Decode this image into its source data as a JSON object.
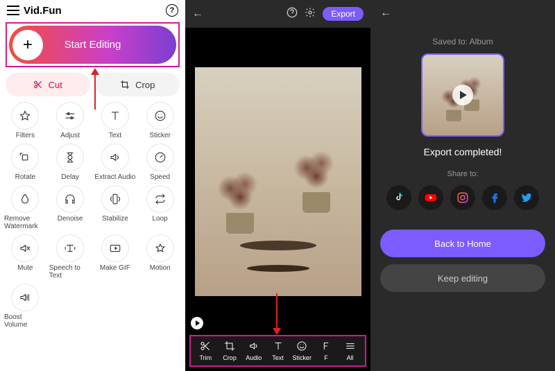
{
  "pane1": {
    "brand": "Vid.Fun",
    "start_label": "Start Editing",
    "cut_label": "Cut",
    "crop_label": "Crop",
    "tools": [
      {
        "label": "Filters",
        "icon": "star"
      },
      {
        "label": "Adjust",
        "icon": "sliders"
      },
      {
        "label": "Text",
        "icon": "text"
      },
      {
        "label": "Sticker",
        "icon": "smile"
      },
      {
        "label": "Rotate",
        "icon": "rotate"
      },
      {
        "label": "Delay",
        "icon": "hourglass"
      },
      {
        "label": "Extract Audio",
        "icon": "audio"
      },
      {
        "label": "Speed",
        "icon": "speed"
      },
      {
        "label": "Remove Watermark",
        "icon": "drop"
      },
      {
        "label": "Denoise",
        "icon": "headphones"
      },
      {
        "label": "Stabilize",
        "icon": "phone"
      },
      {
        "label": "Loop",
        "icon": "loop"
      },
      {
        "label": "Mute",
        "icon": "mute"
      },
      {
        "label": "Speech to Text",
        "icon": "tts"
      },
      {
        "label": "Make GIF",
        "icon": "gif"
      },
      {
        "label": "Motion",
        "icon": "motion"
      },
      {
        "label": "Boost Volume",
        "icon": "boost"
      }
    ]
  },
  "pane2": {
    "export_label": "Export",
    "bottom_tools": [
      {
        "label": "Trim",
        "icon": "scissors"
      },
      {
        "label": "Crop",
        "icon": "crop"
      },
      {
        "label": "Audio",
        "icon": "audio"
      },
      {
        "label": "Text",
        "icon": "text"
      },
      {
        "label": "Sticker",
        "icon": "smile"
      },
      {
        "label": "F",
        "icon": "f"
      },
      {
        "label": "All",
        "icon": "menu"
      }
    ]
  },
  "pane3": {
    "saved_to": "Saved to: Album",
    "export_done": "Export completed!",
    "share_label": "Share to:",
    "share_targets": [
      "tiktok",
      "youtube",
      "instagram",
      "facebook",
      "twitter"
    ],
    "back_home": "Back to Home",
    "keep_editing": "Keep editing"
  }
}
